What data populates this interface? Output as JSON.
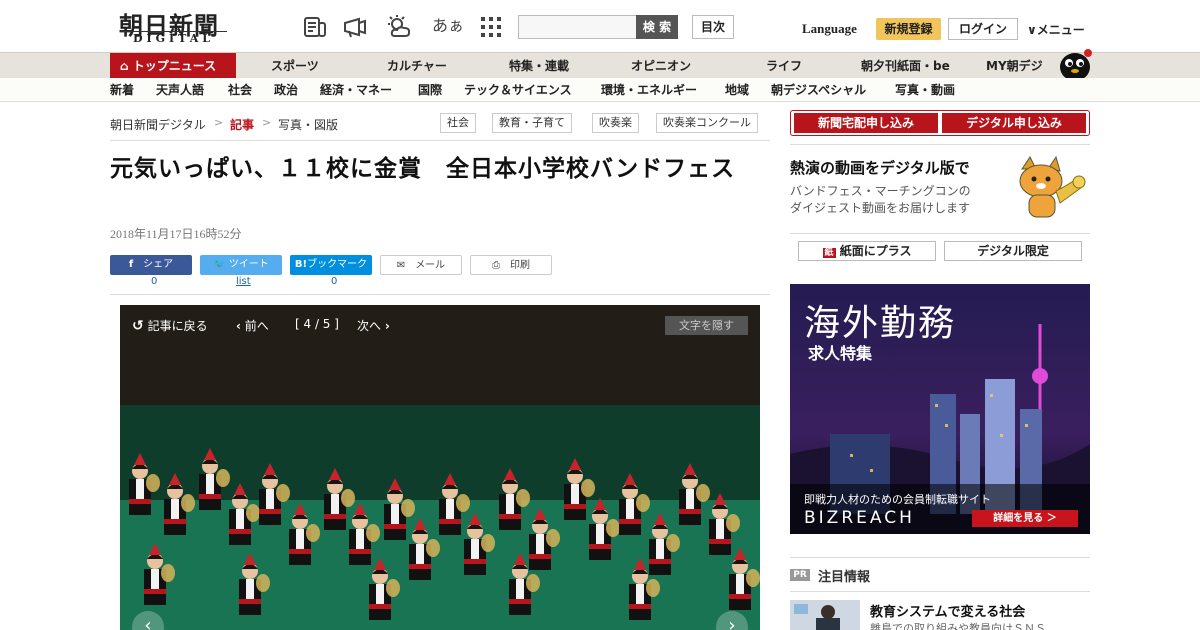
{
  "header": {
    "logo_main": "朝日新聞",
    "logo_sub": "DIGITAL",
    "font_toggle": "あぁ",
    "search_label": "検 索",
    "toc_label": "目次",
    "language_label": "Language",
    "register_label": "新規登録",
    "login_label": "ログイン",
    "menu_label": "メニュー"
  },
  "nav_primary": {
    "top_news": "トップニュース",
    "items": [
      "スポーツ",
      "カルチャー",
      "特集・連載",
      "オピニオン",
      "ライフ",
      "朝夕刊紙面・be",
      "MY朝デジ"
    ]
  },
  "nav_secondary": {
    "items": [
      "新着",
      "天声人語",
      "社会",
      "政治",
      "経済・マネー",
      "国際",
      "テック＆サイエンス",
      "環境・エネルギー",
      "地域",
      "朝デジスペシャル",
      "写真・動画"
    ]
  },
  "breadcrumb": [
    "朝日新聞デジタル",
    "記事",
    "写真・図版"
  ],
  "tags": [
    "社会",
    "教育・子育て",
    "吹奏楽",
    "吹奏楽コンクール"
  ],
  "article": {
    "title": "元気いっぱい、１１校に金賞　全日本小学校バンドフェス",
    "date": "2018年11月17日16時52分"
  },
  "share": {
    "facebook": "シェア",
    "twitter": "ツイート",
    "hatena": "ブックマーク",
    "mail": "メール",
    "print": "印刷",
    "facebook_count": "0",
    "twitter_count": "list",
    "hatena_count": "0"
  },
  "viewer": {
    "back": "記事に戻る",
    "prev": "前へ",
    "position": "[ 4 / 5 ]",
    "next": "次へ",
    "hide_text": "文字を隠す"
  },
  "sidebar": {
    "btn_newspaper": "新聞宅配申し込み",
    "btn_digital": "デジタル申し込み",
    "promo_title": "熱演の動画をデジタル版で",
    "promo_line1": "バンドフェス・マーチングコンの",
    "promo_line2": "ダイジェスト動画をお届けします",
    "btn_plus": "紙面にプラス",
    "btn_limited": "デジタル限定"
  },
  "ad": {
    "headline": "海外勤務",
    "subhead": "求人特集",
    "tagline": "即戦力人材のための会員制転職サイト",
    "brand": "BIZREACH",
    "cta": "詳細を見る ＞"
  },
  "pr": {
    "badge": "PR",
    "title": "注目情報",
    "item_title": "教育システムで変える社会",
    "item_text": "離島での取り組みや教員向けＳＮＳ"
  },
  "colors": {
    "brand_red": "#b8141b",
    "facebook": "#3b5998",
    "twitter": "#55acee",
    "hatena": "#008fde",
    "register_yellow": "#f2c55a"
  }
}
